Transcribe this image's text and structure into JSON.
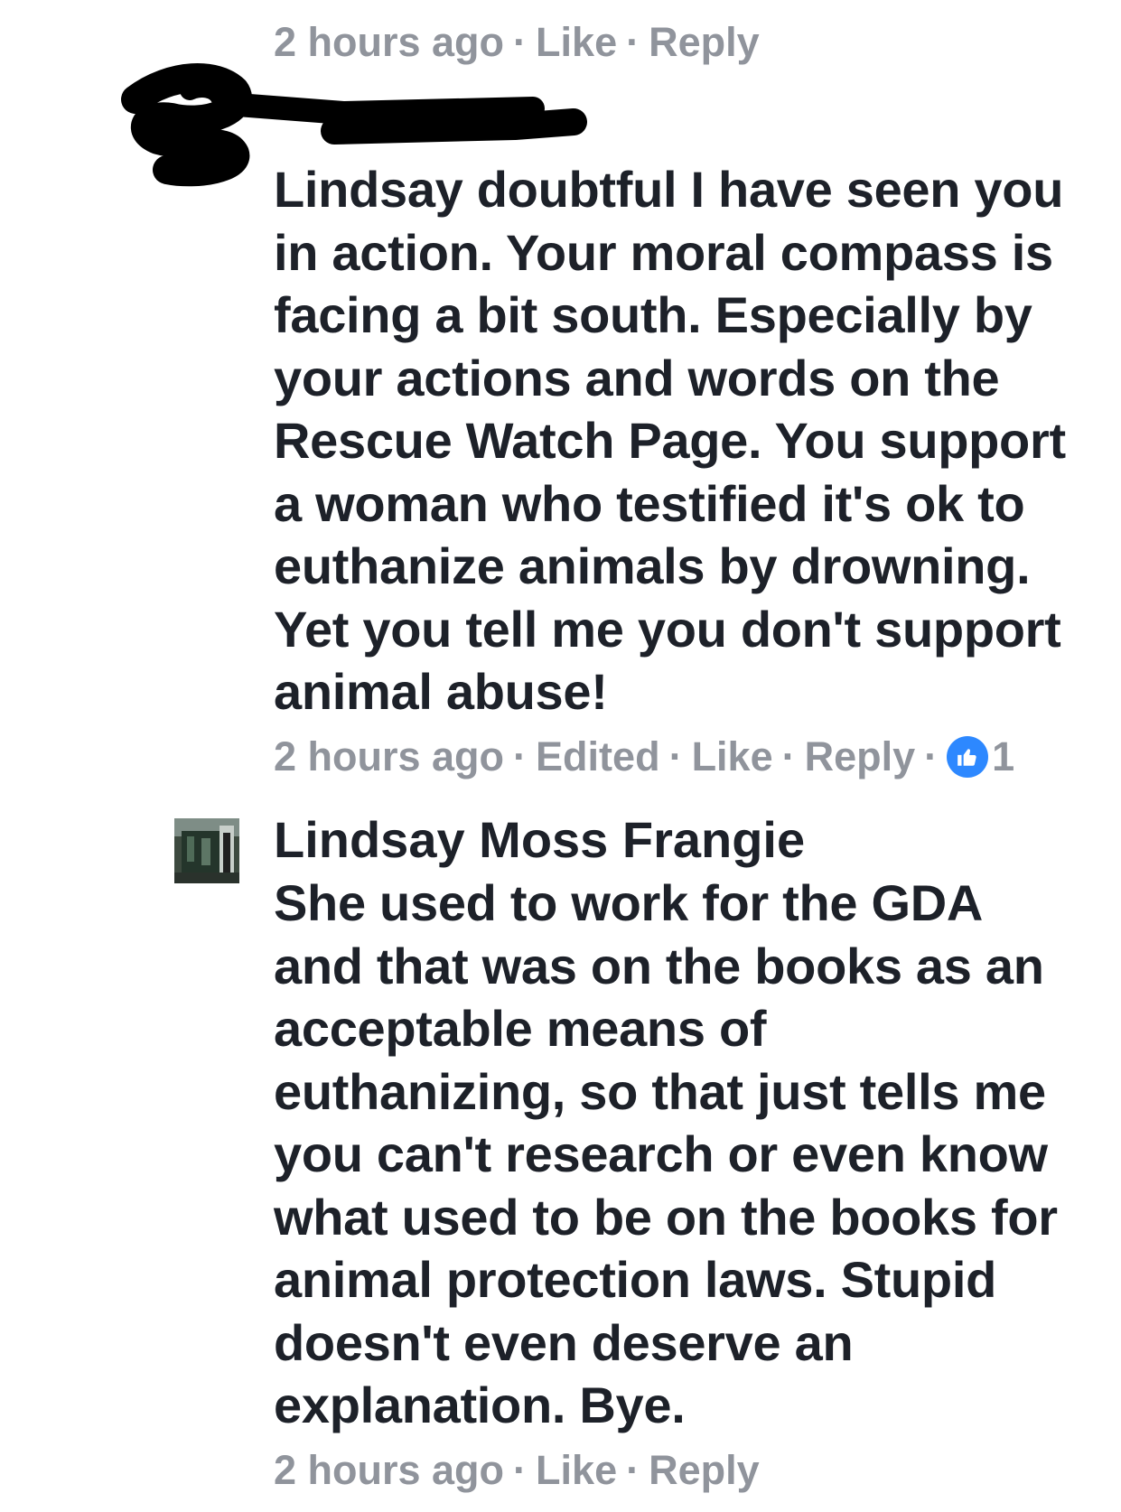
{
  "top_meta": {
    "time": "2 hours ago",
    "like_label": "Like",
    "reply_label": "Reply"
  },
  "comment1": {
    "lines": [
      "Lindsay doubtful I have seen you",
      "in action. Your moral compass is",
      "facing a bit south. Especially by",
      "your actions and words on the",
      "Rescue Watch Page. You support",
      "a woman who testified it's ok to",
      "euthanize animals by drowning.",
      "Yet you tell me you don't support",
      "animal abuse!"
    ],
    "meta": {
      "time": "2 hours ago",
      "edited_label": "Edited",
      "like_label": "Like",
      "reply_label": "Reply",
      "reaction_count": "1",
      "reaction_icon": "like-icon"
    }
  },
  "comment2": {
    "author": "Lindsay Moss Frangie",
    "lines": [
      "She used to work for the GDA",
      "and that was on the books as an",
      "acceptable means of",
      "euthanizing, so that just tells me",
      "you can't research or even know",
      "what used to be on the books for",
      "animal protection laws. Stupid",
      "doesn't even deserve an",
      "explanation. Bye."
    ],
    "meta": {
      "time": "2 hours ago",
      "like_label": "Like",
      "reply_label": "Reply"
    }
  },
  "colors": {
    "text": "#1d2129",
    "meta": "#90949c",
    "like_blue": "#2d88ff",
    "redaction": "#000000"
  }
}
